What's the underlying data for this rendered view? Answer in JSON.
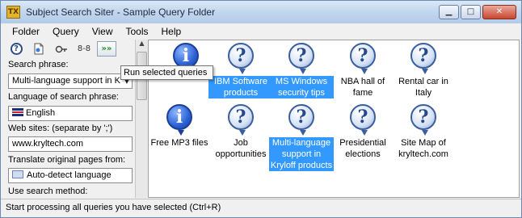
{
  "window": {
    "title": "Subject Search Siter - Sample Query Folder",
    "icon_text": "TX"
  },
  "window_buttons": {
    "minimize": "▁",
    "maximize": "□",
    "close": "✕"
  },
  "menu": [
    "Folder",
    "Query",
    "View",
    "Tools",
    "Help"
  ],
  "toolbar": {
    "buttons": [
      "help-icon",
      "page-icon",
      "tools-icon",
      "binoculars-icon",
      "run-queries-icon"
    ],
    "run_label": "»»",
    "binoculars_label": "8-8",
    "tooltip": "Run selected queries"
  },
  "form": {
    "search_phrase_label": "Search phrase:",
    "search_phrase_value": "Multi-language support in K",
    "language_label": "Language of search phrase:",
    "language_value": "English",
    "websites_label": "Web sites: (separate by ';')",
    "websites_value": "www.kryltech.com",
    "translate_label": "Translate original pages from:",
    "translate_value": "Auto-detect language",
    "method_label": "Use search method:"
  },
  "queries": [
    {
      "label": "",
      "icon": "info-icon",
      "selected": false
    },
    {
      "label": "IBM Software products",
      "icon": "question-icon",
      "selected": true
    },
    {
      "label": "MS Windows security tips",
      "icon": "question-icon",
      "selected": true
    },
    {
      "label": "NBA hall of fame",
      "icon": "question-icon",
      "selected": false
    },
    {
      "label": "Rental car in Italy",
      "icon": "question-icon",
      "selected": false
    },
    {
      "label": "Free MP3 files",
      "icon": "info-icon",
      "selected": false
    },
    {
      "label": "Job opportunities",
      "icon": "question-icon",
      "selected": false
    },
    {
      "label": "Multi-language support in Kryloff products",
      "icon": "question-icon",
      "selected": true
    },
    {
      "label": "Presidential elections",
      "icon": "question-icon",
      "selected": false
    },
    {
      "label": "Site Map of kryltech.com",
      "icon": "question-icon",
      "selected": false
    }
  ],
  "status": "Start processing all queries you have selected (Ctrl+R)"
}
